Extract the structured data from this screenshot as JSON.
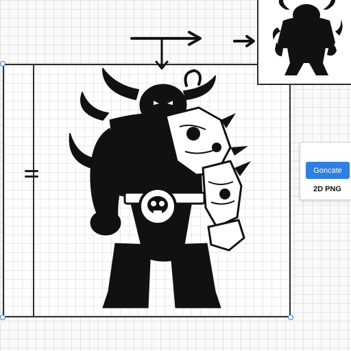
{
  "export_panel": {
    "generate_label": "Goncate",
    "format_label": "2D PNG"
  },
  "icons": {
    "arrow_right_primary": "arrow-right-icon",
    "arrow_right_secondary": "arrow-right-icon",
    "arrow_down": "arrow-down-icon",
    "side_marker": "equals-icon"
  },
  "colors": {
    "accent": "#2f7fe0",
    "silhouette": "#111111",
    "frame": "#2a2a2a",
    "handle": "#3a7bd5"
  }
}
